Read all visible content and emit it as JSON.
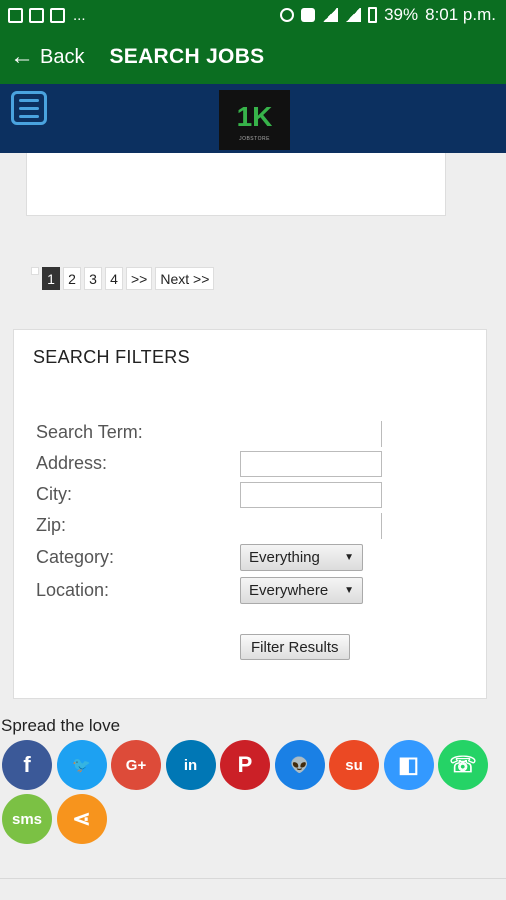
{
  "status_bar": {
    "dots": "...",
    "battery": "39%",
    "time": "8:01 p.m."
  },
  "app_bar": {
    "back_label": "Back",
    "title": "SEARCH JOBS"
  },
  "header": {
    "logo_text": "1K",
    "logo_subtext": "JOBSTORE"
  },
  "pagination": {
    "pages": [
      "1",
      "2",
      "3",
      "4"
    ],
    "skip": ">>",
    "next": "Next >>",
    "current": "1"
  },
  "filters": {
    "title": "SEARCH FILTERS",
    "search_term_label": "Search Term:",
    "address_label": "Address:",
    "city_label": "City:",
    "zip_label": "Zip:",
    "category_label": "Category:",
    "category_value": "Everything",
    "location_label": "Location:",
    "location_value": "Everywhere",
    "button_label": "Filter Results"
  },
  "share": {
    "heading": "Spread the love",
    "items": [
      {
        "icon": "facebook-icon",
        "glyph": "f",
        "color": "#3b5998"
      },
      {
        "icon": "twitter-icon",
        "glyph": "🐦",
        "color": "#1da1f2"
      },
      {
        "icon": "google-plus-icon",
        "glyph": "G+",
        "color": "#dd4b39"
      },
      {
        "icon": "linkedin-icon",
        "glyph": "in",
        "color": "#0077b5"
      },
      {
        "icon": "pinterest-icon",
        "glyph": "P",
        "color": "#cb2027"
      },
      {
        "icon": "reddit-icon",
        "glyph": "👽",
        "color": "#1a80e5"
      },
      {
        "icon": "stumbleupon-icon",
        "glyph": "su",
        "color": "#eb4924"
      },
      {
        "icon": "delicious-icon",
        "glyph": "◧",
        "color": "#3399ff"
      },
      {
        "icon": "whatsapp-icon",
        "glyph": "☏",
        "color": "#25d366"
      },
      {
        "icon": "sms-icon",
        "glyph": "sms",
        "color": "#7bc144"
      },
      {
        "icon": "share-icon",
        "glyph": "⋖",
        "color": "#f7941d"
      }
    ]
  }
}
